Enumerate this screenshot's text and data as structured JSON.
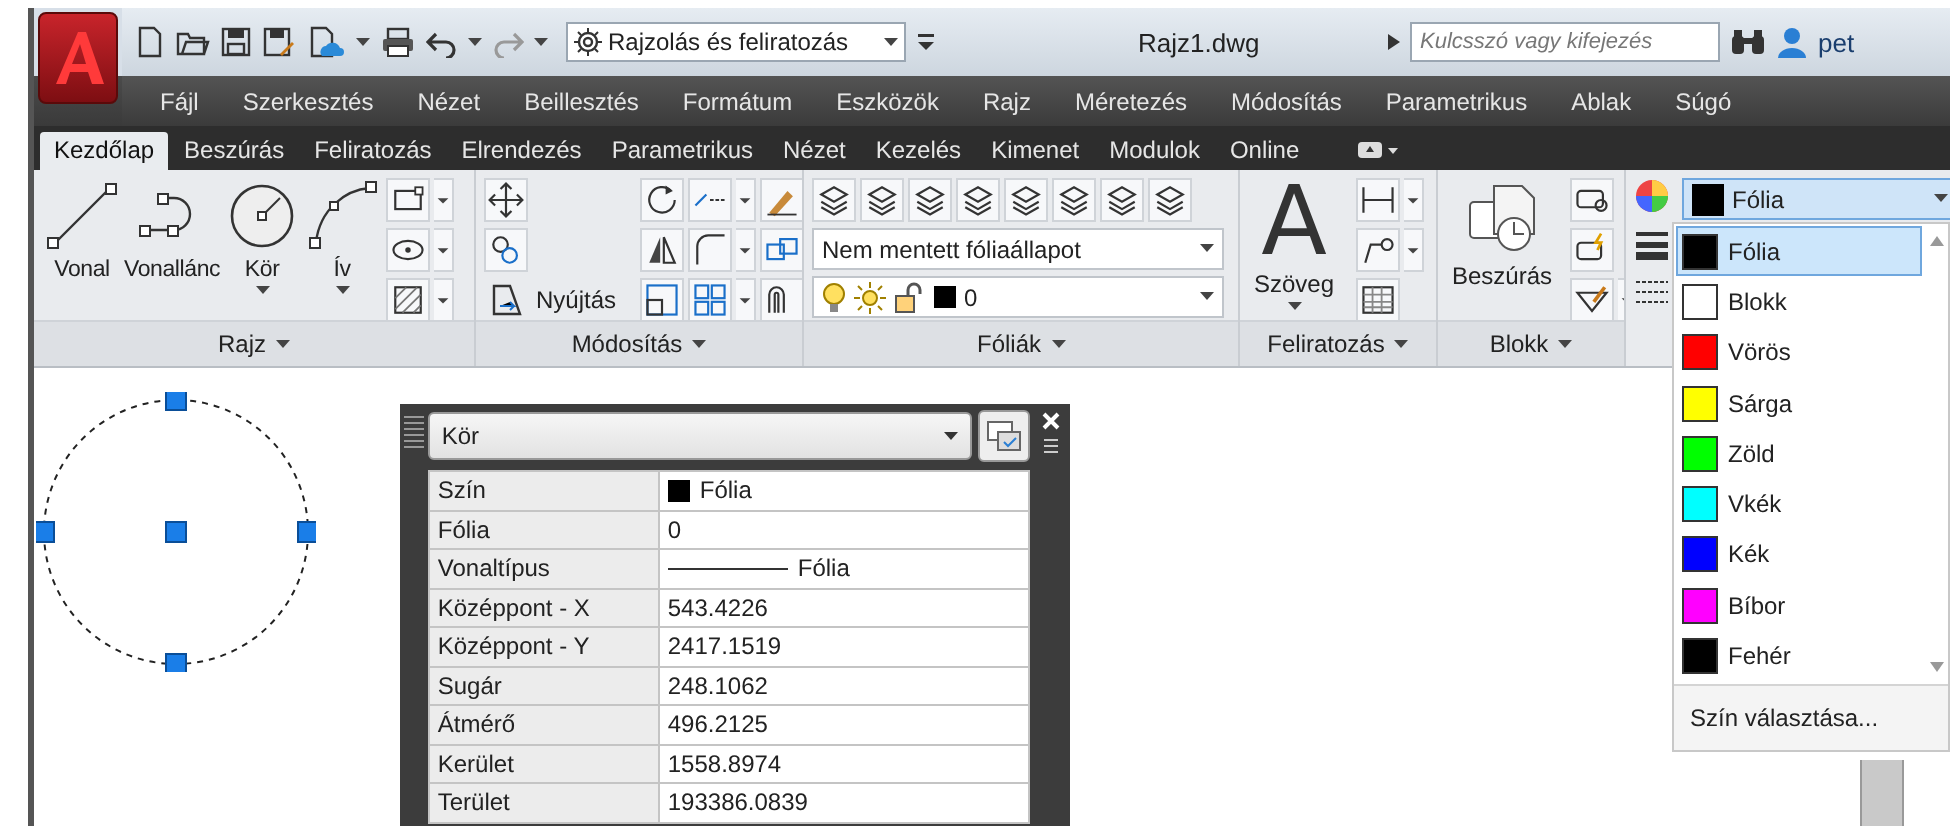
{
  "title_bar": {
    "workspace": "Rajzolás és feliratozás",
    "title": "Rajz1.dwg",
    "search_placeholder": "Kulcsszó vagy kifejezés",
    "user": "pet"
  },
  "menu_bar": [
    "Fájl",
    "Szerkesztés",
    "Nézet",
    "Beillesztés",
    "Formátum",
    "Eszközök",
    "Rajz",
    "Méretezés",
    "Módosítás",
    "Parametrikus",
    "Ablak",
    "Súgó"
  ],
  "ribbon_tabs": [
    {
      "label": "Kezdőlap",
      "selected": true
    },
    {
      "label": "Beszúrás",
      "selected": false
    },
    {
      "label": "Feliratozás",
      "selected": false
    },
    {
      "label": "Elrendezés",
      "selected": false
    },
    {
      "label": "Parametrikus",
      "selected": false
    },
    {
      "label": "Nézet",
      "selected": false
    },
    {
      "label": "Kezelés",
      "selected": false
    },
    {
      "label": "Kimenet",
      "selected": false
    },
    {
      "label": "Modulok",
      "selected": false
    },
    {
      "label": "Online",
      "selected": false
    }
  ],
  "ribbon_panels": [
    {
      "kind": "draw",
      "title": "Rajz",
      "tools": [
        {
          "label": "Vonal",
          "dropdown": false
        },
        {
          "label": "Vonallánc",
          "dropdown": false
        },
        {
          "label": "Kör",
          "dropdown": true
        },
        {
          "label": "Ív",
          "dropdown": true
        }
      ]
    },
    {
      "kind": "modify",
      "title": "Módosítás",
      "stretch_label": "Nyújtás"
    },
    {
      "kind": "layers",
      "title": "Fóliák",
      "layer_state": "Nem mentett fóliaállapot",
      "current_layer": "0"
    },
    {
      "kind": "annotation",
      "title": "Feliratozás",
      "icon_glyph": "A",
      "label": "Szöveg"
    },
    {
      "kind": "block",
      "title": "Blokk",
      "label": "Beszúrás"
    },
    {
      "kind": "properties",
      "color_value": "Fólia"
    }
  ],
  "color_list": {
    "items": [
      {
        "label": "Fólia",
        "color": "#000000",
        "selected": true
      },
      {
        "label": "Blokk",
        "color": "#ffffff",
        "selected": false
      },
      {
        "label": "Vörös",
        "color": "#ff0000",
        "selected": false
      },
      {
        "label": "Sárga",
        "color": "#ffff00",
        "selected": false
      },
      {
        "label": "Zöld",
        "color": "#00ff00",
        "selected": false
      },
      {
        "label": "Vkék",
        "color": "#00ffff",
        "selected": false
      },
      {
        "label": "Kék",
        "color": "#0000ff",
        "selected": false
      },
      {
        "label": "Bíbor",
        "color": "#ff00ff",
        "selected": false
      },
      {
        "label": "Fehér",
        "color": "#000000",
        "selected": false
      }
    ],
    "footer": "Szín választása..."
  },
  "properties_palette": {
    "object_type": "Kör",
    "rows": [
      {
        "label": "Szín",
        "value": "Fólia",
        "kind": "color"
      },
      {
        "label": "Fólia",
        "value": "0",
        "kind": "text"
      },
      {
        "label": "Vonaltípus",
        "value": "Fólia",
        "kind": "linetype"
      },
      {
        "label": "Középpont - X",
        "value": "543.4226",
        "kind": "text"
      },
      {
        "label": "Középpont - Y",
        "value": "2417.1519",
        "kind": "text"
      },
      {
        "label": "Sugár",
        "value": "248.1062",
        "kind": "text"
      },
      {
        "label": "Átmérő",
        "value": "496.2125",
        "kind": "text"
      },
      {
        "label": "Kerület",
        "value": "1558.8974",
        "kind": "text"
      },
      {
        "label": "Terület",
        "value": "193386.0839",
        "kind": "text"
      }
    ]
  }
}
